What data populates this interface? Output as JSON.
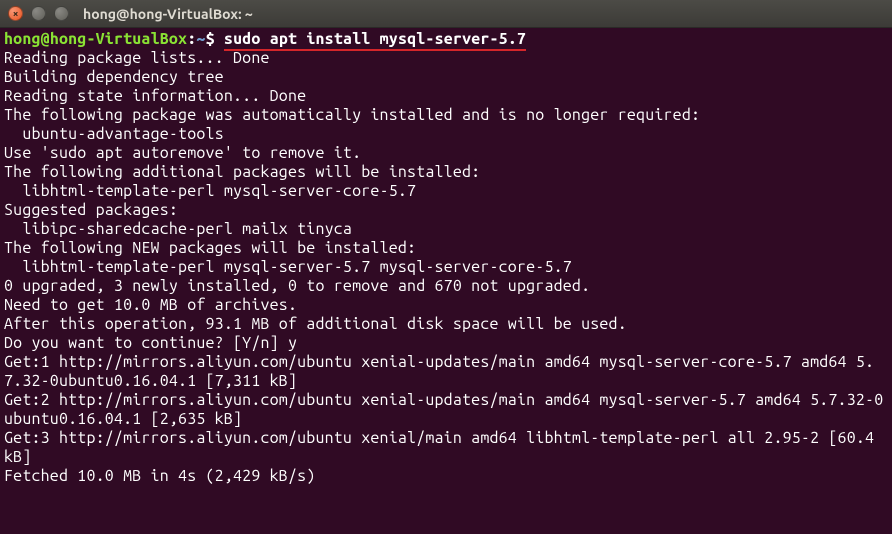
{
  "window": {
    "title": "hong@hong-VirtualBox: ~"
  },
  "prompt": {
    "user": "hong",
    "at": "@",
    "host": "hong-VirtualBox",
    "colon": ":",
    "path": "~",
    "dollar": "$"
  },
  "command": "sudo apt install mysql-server-5.7",
  "output_lines": {
    "l1": "Reading package lists... Done",
    "l2": "Building dependency tree",
    "l3": "Reading state information... Done",
    "l4": "The following package was automatically installed and is no longer required:",
    "l5": "  ubuntu-advantage-tools",
    "l6": "Use 'sudo apt autoremove' to remove it.",
    "l7": "The following additional packages will be installed:",
    "l8": "  libhtml-template-perl mysql-server-core-5.7",
    "l9": "Suggested packages:",
    "l10": "  libipc-sharedcache-perl mailx tinyca",
    "l11": "The following NEW packages will be installed:",
    "l12": "  libhtml-template-perl mysql-server-5.7 mysql-server-core-5.7",
    "l13": "0 upgraded, 3 newly installed, 0 to remove and 670 not upgraded.",
    "l14": "Need to get 10.0 MB of archives.",
    "l15": "After this operation, 93.1 MB of additional disk space will be used.",
    "l16": "Do you want to continue? [Y/n] y",
    "l17": "Get:1 http://mirrors.aliyun.com/ubuntu xenial-updates/main amd64 mysql-server-core-5.7 amd64 5.7.32-0ubuntu0.16.04.1 [7,311 kB]",
    "l18": "Get:2 http://mirrors.aliyun.com/ubuntu xenial-updates/main amd64 mysql-server-5.7 amd64 5.7.32-0ubuntu0.16.04.1 [2,635 kB]",
    "l19": "Get:3 http://mirrors.aliyun.com/ubuntu xenial/main amd64 libhtml-template-perl all 2.95-2 [60.4 kB]",
    "l20": "Fetched 10.0 MB in 4s (2,429 kB/s)"
  }
}
